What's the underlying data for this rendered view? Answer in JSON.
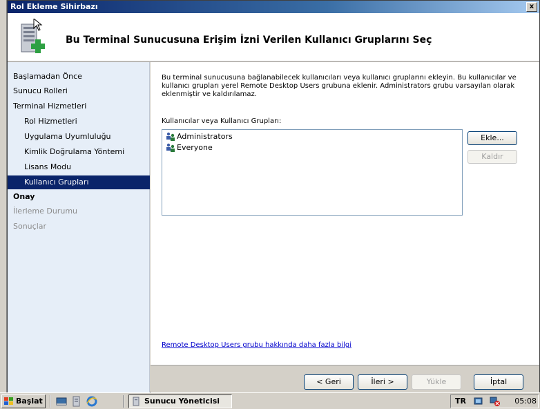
{
  "window": {
    "title": "Rol Ekleme Sihirbazı",
    "close_label": "x"
  },
  "header": {
    "title": "Bu Terminal Sunucusuna Erişim İzni Verilen Kullanıcı Gruplarını Seç",
    "icon": "server-add-icon"
  },
  "sidebar": {
    "items": [
      {
        "label": "Başlamadan Önce",
        "level": 0,
        "state": "normal"
      },
      {
        "label": "Sunucu Rolleri",
        "level": 0,
        "state": "normal"
      },
      {
        "label": "Terminal Hizmetleri",
        "level": 0,
        "state": "normal"
      },
      {
        "label": "Rol Hizmetleri",
        "level": 1,
        "state": "normal"
      },
      {
        "label": "Uygulama Uyumluluğu",
        "level": 1,
        "state": "normal"
      },
      {
        "label": "Kimlik Doğrulama Yöntemi",
        "level": 1,
        "state": "normal"
      },
      {
        "label": "Lisans Modu",
        "level": 1,
        "state": "normal"
      },
      {
        "label": "Kullanıcı Grupları",
        "level": 1,
        "state": "active"
      },
      {
        "label": "Onay",
        "level": 0,
        "state": "bold"
      },
      {
        "label": "İlerleme Durumu",
        "level": 0,
        "state": "disabled"
      },
      {
        "label": "Sonuçlar",
        "level": 0,
        "state": "disabled"
      }
    ]
  },
  "main": {
    "intro": "Bu terminal sunucusuna bağlanabilecek kullanıcıları veya kullanıcı gruplarını ekleyin. Bu kullanıcılar ve kullanıcı grupları yerel Remote Desktop Users grubuna eklenir. Administrators grubu varsayılan olarak eklenmiştir ve kaldırılamaz.",
    "list_label": "Kullanıcılar veya Kullanıcı Grupları:",
    "groups": [
      "Administrators",
      "Everyone"
    ],
    "group_icon": "user-group-icon",
    "add_label": "Ekle...",
    "remove_label": "Kaldır",
    "more_info_link": "Remote Desktop Users grubu hakkında daha fazla bilgi"
  },
  "footer": {
    "back_label": "< Geri",
    "next_label": "İleri >",
    "install_label": "Yükle",
    "cancel_label": "İptal"
  },
  "taskbar": {
    "start_label": "Başlat",
    "quick_launch": [
      "show-desktop-icon",
      "server-manager-icon",
      "internet-explorer-icon"
    ],
    "task_label": "Sunucu Yöneticisi",
    "language": "TR",
    "tray_icons": [
      "network-icon",
      "network-alert-icon"
    ],
    "clock": "05:08"
  },
  "colors": {
    "title_bar": "#0a246a",
    "sidebar_bg": "#e6eef8",
    "active_item": "#0a246a",
    "link": "#0000cc"
  }
}
